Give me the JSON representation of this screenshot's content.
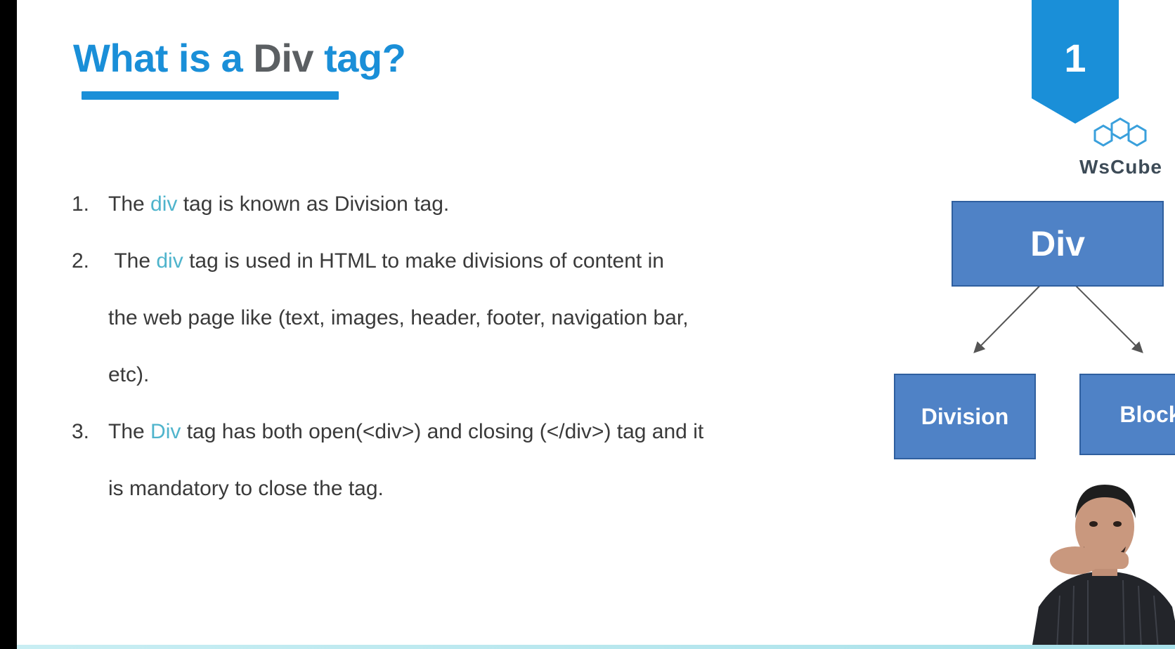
{
  "slide": {
    "title_parts": [
      "What is a ",
      "Div",
      " tag?"
    ],
    "badge_number": "1",
    "logo_text": "WsCube",
    "points": [
      {
        "num": "1.",
        "lines": [
          {
            "pre": "The ",
            "kw": "div",
            "post": " tag is known as Division tag."
          }
        ]
      },
      {
        "num": "2.",
        "lines": [
          {
            "pre": "The ",
            "kw": "div",
            "post": " tag is used in HTML to make divisions of content in"
          },
          {
            "pre": "the web page like (text, images, header, footer, navigation bar,",
            "kw": "",
            "post": ""
          },
          {
            "pre": "etc).",
            "kw": "",
            "post": ""
          }
        ]
      },
      {
        "num": "3.",
        "lines": [
          {
            "pre": "The ",
            "kw": "Div",
            "post": " tag has both open(<div>) and closing (</div>) tag and it"
          },
          {
            "pre": "is mandatory to close the tag.",
            "kw": "",
            "post": ""
          }
        ]
      }
    ]
  },
  "diagram": {
    "root": "Div",
    "children": [
      "Division",
      "Block"
    ]
  },
  "colors": {
    "accent": "#1a8fd8",
    "keyword": "#4fb4cc",
    "node_fill": "#4f82c6",
    "title_gray": "#5b5f62"
  }
}
